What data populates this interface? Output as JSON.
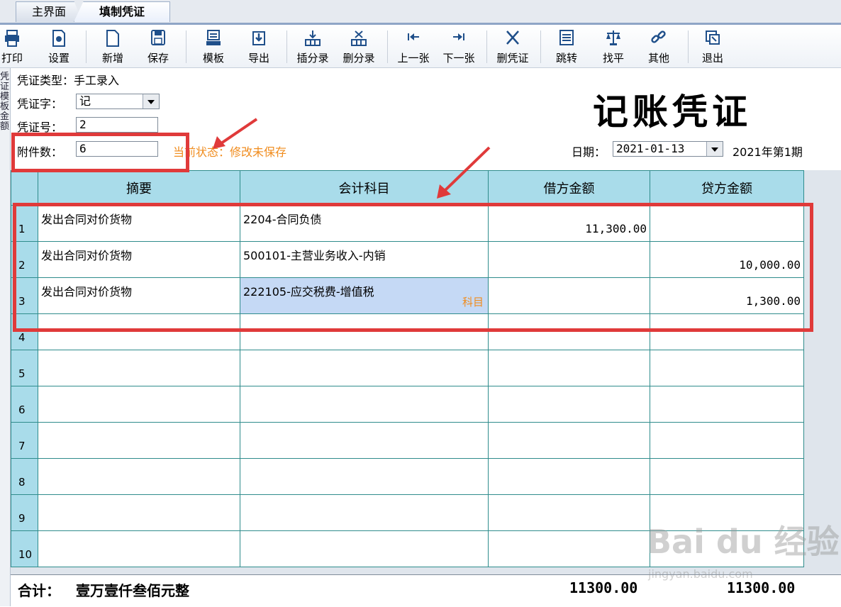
{
  "tabs": {
    "main": "主界面",
    "active": "填制凭证"
  },
  "toolbar": [
    {
      "label": "打印",
      "icon": "printer-icon"
    },
    {
      "label": "设置",
      "icon": "settings-icon"
    },
    {
      "label": "新增",
      "icon": "new-doc-icon"
    },
    {
      "label": "保存",
      "icon": "save-icon"
    },
    {
      "label": "模板",
      "icon": "template-icon"
    },
    {
      "label": "导出",
      "icon": "export-icon"
    },
    {
      "label": "插分录",
      "icon": "insert-row-icon"
    },
    {
      "label": "删分录",
      "icon": "delete-row-icon"
    },
    {
      "label": "上一张",
      "icon": "prev-icon"
    },
    {
      "label": "下一张",
      "icon": "next-icon"
    },
    {
      "label": "删凭证",
      "icon": "delete-voucher-icon"
    },
    {
      "label": "跳转",
      "icon": "jump-icon"
    },
    {
      "label": "找平",
      "icon": "balance-icon"
    },
    {
      "label": "其他",
      "icon": "link-icon"
    },
    {
      "label": "退出",
      "icon": "exit-icon"
    }
  ],
  "sidebar": {
    "text": "凭证模板 金额"
  },
  "header": {
    "type_label": "凭证类型：手工录入",
    "char_label": "凭证字：",
    "char_value": "记",
    "num_label": "凭证号：",
    "num_value": "2",
    "att_label": "附件数：",
    "att_value": "6",
    "status": "当前状态：修改未保存",
    "title": "记账凭证",
    "date_label": "日期：",
    "date_value": "2021-01-13",
    "period": "2021年第1期"
  },
  "table": {
    "headers": [
      "摘要",
      "会计科目",
      "借方金额",
      "贷方金额"
    ],
    "rows": [
      {
        "no": "1",
        "summary": "发出合同对价货物",
        "account": "2204-合同负债",
        "debit": "11,300.00",
        "credit": ""
      },
      {
        "no": "2",
        "summary": "发出合同对价货物",
        "account": "500101-主营业务收入-内销",
        "debit": "",
        "credit": "10,000.00"
      },
      {
        "no": "3",
        "summary": "发出合同对价货物",
        "account": "222105-应交税费-增值税",
        "debit": "",
        "credit": "1,300.00",
        "hint": "科目"
      },
      {
        "no": "4",
        "summary": "",
        "account": "",
        "debit": "",
        "credit": ""
      },
      {
        "no": "5",
        "summary": "",
        "account": "",
        "debit": "",
        "credit": ""
      },
      {
        "no": "6",
        "summary": "",
        "account": "",
        "debit": "",
        "credit": ""
      },
      {
        "no": "7",
        "summary": "",
        "account": "",
        "debit": "",
        "credit": ""
      },
      {
        "no": "8",
        "summary": "",
        "account": "",
        "debit": "",
        "credit": ""
      },
      {
        "no": "9",
        "summary": "",
        "account": "",
        "debit": "",
        "credit": ""
      },
      {
        "no": "10",
        "summary": "",
        "account": "",
        "debit": "",
        "credit": ""
      }
    ]
  },
  "footer": {
    "total_label": "合计：",
    "total_words": "壹万壹仟叁佰元整",
    "debit_total": "11300.00",
    "credit_total": "11300.00"
  },
  "watermark": {
    "brand": "Bai du 经验",
    "url": "jingyan.baidu.com"
  },
  "colors": {
    "header_bg": "#a9dcea",
    "grid_line": "#2f8c8c",
    "status": "#f08c1e",
    "annotation": "#e03a3a",
    "selected_cell": "#c5d9f5"
  }
}
